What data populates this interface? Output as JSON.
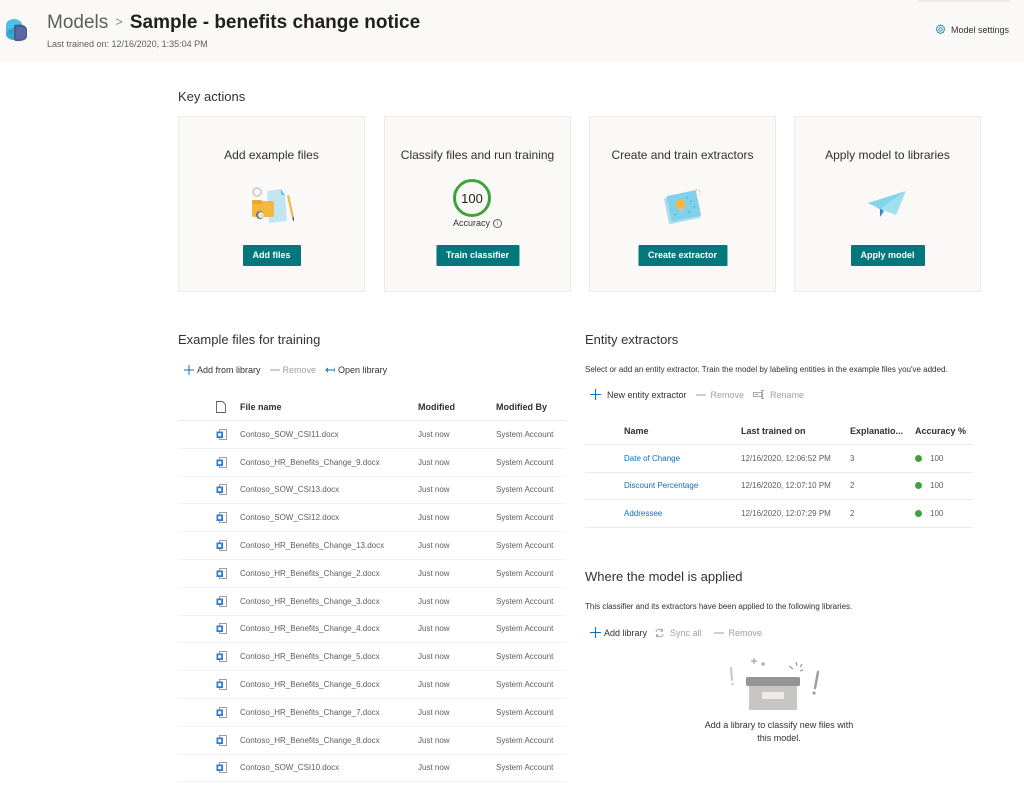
{
  "header": {
    "breadcrumb_root": "Models",
    "breadcrumb_separator": ">",
    "title": "Sample - benefits change notice",
    "last_trained": "Last trained on: 12/16/2020, 1:35:04 PM",
    "model_settings_label": "Model settings",
    "icons": {
      "app": "syntex-model-icon",
      "settings": "gear-icon"
    }
  },
  "key_actions": {
    "title": "Key actions",
    "cards": [
      {
        "title": "Add example files",
        "button": "Add files",
        "illustration": "files-illustration"
      },
      {
        "title": "Classify files and run training",
        "button": "Train classifier",
        "accuracy_value": "100",
        "accuracy_label": "Accuracy",
        "info_glyph": "i"
      },
      {
        "title": "Create and train extractors",
        "button": "Create extractor",
        "illustration": "lightbulb-notebook-illustration"
      },
      {
        "title": "Apply model to libraries",
        "button": "Apply model",
        "illustration": "paper-plane-illustration"
      }
    ],
    "button_color": "#03787c",
    "accuracy_ring_color": "#3fa33a"
  },
  "example_files": {
    "title": "Example files for training",
    "commands": [
      {
        "label": "Add from library",
        "icon": "plus-icon",
        "enabled": true
      },
      {
        "label": "Remove",
        "icon": "minus-icon",
        "enabled": false
      },
      {
        "label": "Open library",
        "icon": "open-arrow-icon",
        "enabled": true
      }
    ],
    "columns": [
      "File name",
      "Modified",
      "Modified By"
    ],
    "rows": [
      {
        "name": "Contoso_SOW_CSI11.docx",
        "modified": "Just now",
        "modified_by": "System Account"
      },
      {
        "name": "Contoso_HR_Benefits_Change_9.docx",
        "modified": "Just now",
        "modified_by": "System Account"
      },
      {
        "name": "Contoso_SOW_CSI13.docx",
        "modified": "Just now",
        "modified_by": "System Account"
      },
      {
        "name": "Contoso_SOW_CSI12.docx",
        "modified": "Just now",
        "modified_by": "System Account"
      },
      {
        "name": "Contoso_HR_Benefits_Change_13.docx",
        "modified": "Just now",
        "modified_by": "System Account"
      },
      {
        "name": "Contoso_HR_Benefits_Change_2.docx",
        "modified": "Just now",
        "modified_by": "System Account"
      },
      {
        "name": "Contoso_HR_Benefits_Change_3.docx",
        "modified": "Just now",
        "modified_by": "System Account"
      },
      {
        "name": "Contoso_HR_Benefits_Change_4.docx",
        "modified": "Just now",
        "modified_by": "System Account"
      },
      {
        "name": "Contoso_HR_Benefits_Change_5.docx",
        "modified": "Just now",
        "modified_by": "System Account"
      },
      {
        "name": "Contoso_HR_Benefits_Change_6.docx",
        "modified": "Just now",
        "modified_by": "System Account"
      },
      {
        "name": "Contoso_HR_Benefits_Change_7.docx",
        "modified": "Just now",
        "modified_by": "System Account"
      },
      {
        "name": "Contoso_HR_Benefits_Change_8.docx",
        "modified": "Just now",
        "modified_by": "System Account"
      },
      {
        "name": "Contoso_SOW_CSI10.docx",
        "modified": "Just now",
        "modified_by": "System Account"
      }
    ]
  },
  "entity_extractors": {
    "title": "Entity extractors",
    "description": "Select or add an entity extractor. Train the model by labeling entities in the example files you've added.",
    "commands": [
      {
        "label": "New entity extractor",
        "icon": "plus-icon",
        "enabled": true
      },
      {
        "label": "Remove",
        "icon": "minus-icon",
        "enabled": false
      },
      {
        "label": "Rename",
        "icon": "rename-icon",
        "enabled": false
      }
    ],
    "columns": [
      "Name",
      "Last trained on",
      "Explanatio...",
      "Accuracy %"
    ],
    "rows": [
      {
        "name": "Date of Change",
        "last_trained": "12/16/2020, 12:06:52 PM",
        "explanations": "3",
        "accuracy": "100",
        "status_color": "#3fa33a"
      },
      {
        "name": "Discount Percentage",
        "last_trained": "12/16/2020, 12:07:10 PM",
        "explanations": "2",
        "accuracy": "100",
        "status_color": "#3fa33a"
      },
      {
        "name": "Addressee",
        "last_trained": "12/16/2020, 12:07:29 PM",
        "explanations": "2",
        "accuracy": "100",
        "status_color": "#3fa33a"
      }
    ]
  },
  "where_applied": {
    "title": "Where the model is applied",
    "description": "This classifier and its extractors have been applied to the following libraries.",
    "commands": [
      {
        "label": "Add library",
        "icon": "plus-icon",
        "enabled": true
      },
      {
        "label": "Sync all",
        "icon": "sync-icon",
        "enabled": false
      },
      {
        "label": "Remove",
        "icon": "minus-icon",
        "enabled": false
      }
    ],
    "empty_state": "Add a library to classify new files with this model.",
    "empty_illustration": "empty-box-illustration"
  }
}
